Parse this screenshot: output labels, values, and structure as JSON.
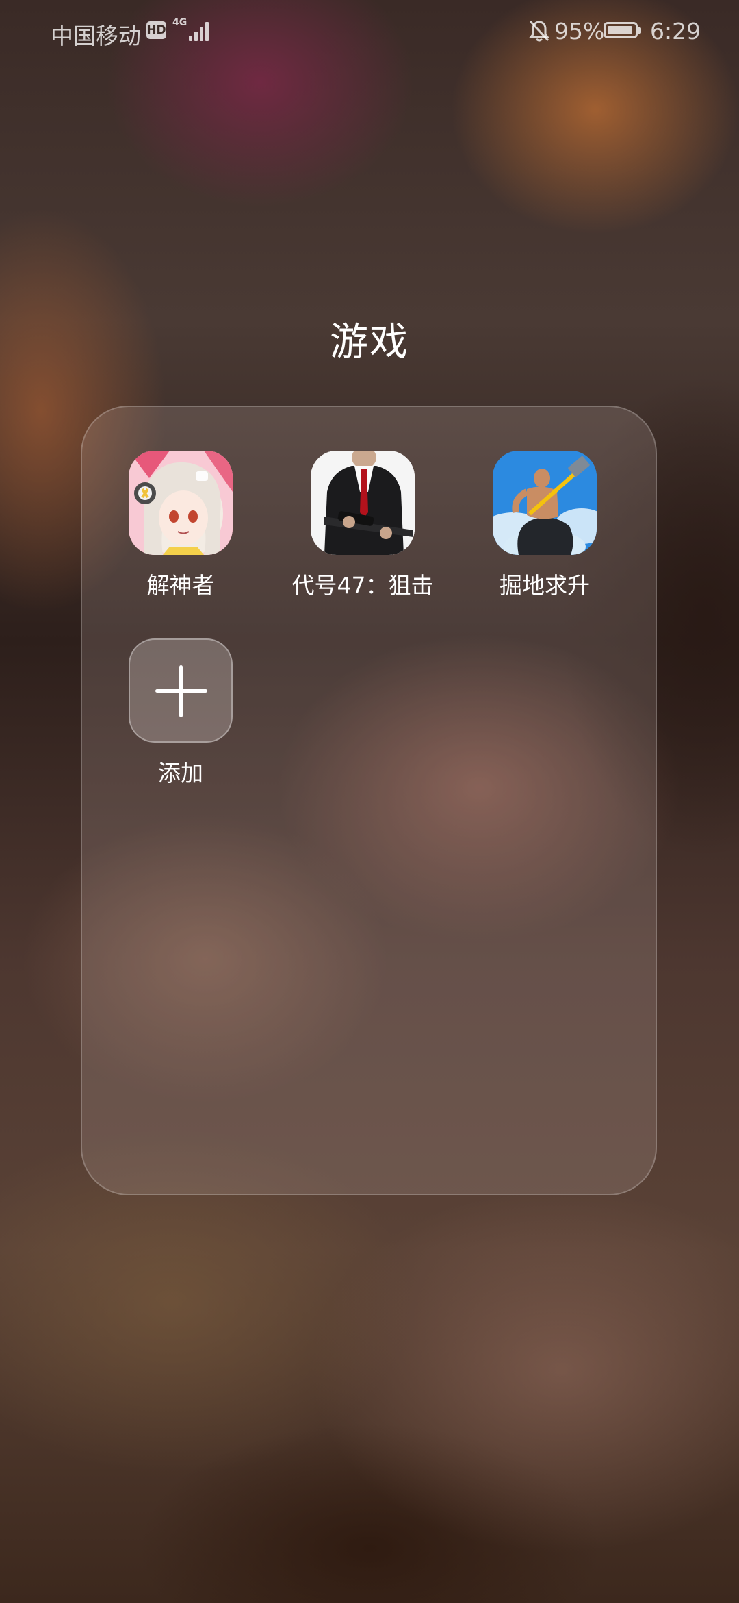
{
  "status_bar": {
    "carrier": "中国移动",
    "hd_badge": "HD",
    "network_type": "4G",
    "battery_percent": "95%",
    "battery_level": 0.95,
    "time": "6:29",
    "icons": [
      "hd-icon",
      "signal-icon",
      "mute-icon",
      "battery-icon"
    ]
  },
  "folder": {
    "title": "游戏",
    "apps": [
      {
        "label": "解神者",
        "icon": "jieshenzhe-app-icon"
      },
      {
        "label": "代号47：狙击",
        "icon": "hitman-sniper-app-icon"
      },
      {
        "label": "掘地求升",
        "icon": "getting-over-it-app-icon"
      }
    ],
    "add_button": {
      "label": "添加",
      "icon": "plus-icon"
    }
  }
}
